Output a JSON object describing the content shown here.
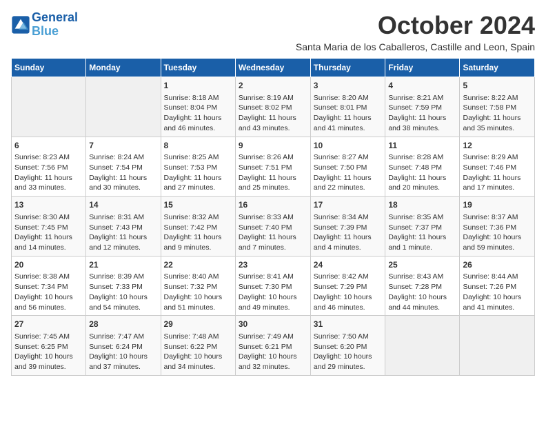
{
  "logo": {
    "line1": "General",
    "line2": "Blue"
  },
  "title": "October 2024",
  "location": "Santa Maria de los Caballeros, Castille and Leon, Spain",
  "days_of_week": [
    "Sunday",
    "Monday",
    "Tuesday",
    "Wednesday",
    "Thursday",
    "Friday",
    "Saturday"
  ],
  "weeks": [
    [
      {
        "day": "",
        "content": ""
      },
      {
        "day": "",
        "content": ""
      },
      {
        "day": "1",
        "content": "Sunrise: 8:18 AM\nSunset: 8:04 PM\nDaylight: 11 hours and 46 minutes."
      },
      {
        "day": "2",
        "content": "Sunrise: 8:19 AM\nSunset: 8:02 PM\nDaylight: 11 hours and 43 minutes."
      },
      {
        "day": "3",
        "content": "Sunrise: 8:20 AM\nSunset: 8:01 PM\nDaylight: 11 hours and 41 minutes."
      },
      {
        "day": "4",
        "content": "Sunrise: 8:21 AM\nSunset: 7:59 PM\nDaylight: 11 hours and 38 minutes."
      },
      {
        "day": "5",
        "content": "Sunrise: 8:22 AM\nSunset: 7:58 PM\nDaylight: 11 hours and 35 minutes."
      }
    ],
    [
      {
        "day": "6",
        "content": "Sunrise: 8:23 AM\nSunset: 7:56 PM\nDaylight: 11 hours and 33 minutes."
      },
      {
        "day": "7",
        "content": "Sunrise: 8:24 AM\nSunset: 7:54 PM\nDaylight: 11 hours and 30 minutes."
      },
      {
        "day": "8",
        "content": "Sunrise: 8:25 AM\nSunset: 7:53 PM\nDaylight: 11 hours and 27 minutes."
      },
      {
        "day": "9",
        "content": "Sunrise: 8:26 AM\nSunset: 7:51 PM\nDaylight: 11 hours and 25 minutes."
      },
      {
        "day": "10",
        "content": "Sunrise: 8:27 AM\nSunset: 7:50 PM\nDaylight: 11 hours and 22 minutes."
      },
      {
        "day": "11",
        "content": "Sunrise: 8:28 AM\nSunset: 7:48 PM\nDaylight: 11 hours and 20 minutes."
      },
      {
        "day": "12",
        "content": "Sunrise: 8:29 AM\nSunset: 7:46 PM\nDaylight: 11 hours and 17 minutes."
      }
    ],
    [
      {
        "day": "13",
        "content": "Sunrise: 8:30 AM\nSunset: 7:45 PM\nDaylight: 11 hours and 14 minutes."
      },
      {
        "day": "14",
        "content": "Sunrise: 8:31 AM\nSunset: 7:43 PM\nDaylight: 11 hours and 12 minutes."
      },
      {
        "day": "15",
        "content": "Sunrise: 8:32 AM\nSunset: 7:42 PM\nDaylight: 11 hours and 9 minutes."
      },
      {
        "day": "16",
        "content": "Sunrise: 8:33 AM\nSunset: 7:40 PM\nDaylight: 11 hours and 7 minutes."
      },
      {
        "day": "17",
        "content": "Sunrise: 8:34 AM\nSunset: 7:39 PM\nDaylight: 11 hours and 4 minutes."
      },
      {
        "day": "18",
        "content": "Sunrise: 8:35 AM\nSunset: 7:37 PM\nDaylight: 11 hours and 1 minute."
      },
      {
        "day": "19",
        "content": "Sunrise: 8:37 AM\nSunset: 7:36 PM\nDaylight: 10 hours and 59 minutes."
      }
    ],
    [
      {
        "day": "20",
        "content": "Sunrise: 8:38 AM\nSunset: 7:34 PM\nDaylight: 10 hours and 56 minutes."
      },
      {
        "day": "21",
        "content": "Sunrise: 8:39 AM\nSunset: 7:33 PM\nDaylight: 10 hours and 54 minutes."
      },
      {
        "day": "22",
        "content": "Sunrise: 8:40 AM\nSunset: 7:32 PM\nDaylight: 10 hours and 51 minutes."
      },
      {
        "day": "23",
        "content": "Sunrise: 8:41 AM\nSunset: 7:30 PM\nDaylight: 10 hours and 49 minutes."
      },
      {
        "day": "24",
        "content": "Sunrise: 8:42 AM\nSunset: 7:29 PM\nDaylight: 10 hours and 46 minutes."
      },
      {
        "day": "25",
        "content": "Sunrise: 8:43 AM\nSunset: 7:28 PM\nDaylight: 10 hours and 44 minutes."
      },
      {
        "day": "26",
        "content": "Sunrise: 8:44 AM\nSunset: 7:26 PM\nDaylight: 10 hours and 41 minutes."
      }
    ],
    [
      {
        "day": "27",
        "content": "Sunrise: 7:45 AM\nSunset: 6:25 PM\nDaylight: 10 hours and 39 minutes."
      },
      {
        "day": "28",
        "content": "Sunrise: 7:47 AM\nSunset: 6:24 PM\nDaylight: 10 hours and 37 minutes."
      },
      {
        "day": "29",
        "content": "Sunrise: 7:48 AM\nSunset: 6:22 PM\nDaylight: 10 hours and 34 minutes."
      },
      {
        "day": "30",
        "content": "Sunrise: 7:49 AM\nSunset: 6:21 PM\nDaylight: 10 hours and 32 minutes."
      },
      {
        "day": "31",
        "content": "Sunrise: 7:50 AM\nSunset: 6:20 PM\nDaylight: 10 hours and 29 minutes."
      },
      {
        "day": "",
        "content": ""
      },
      {
        "day": "",
        "content": ""
      }
    ]
  ]
}
